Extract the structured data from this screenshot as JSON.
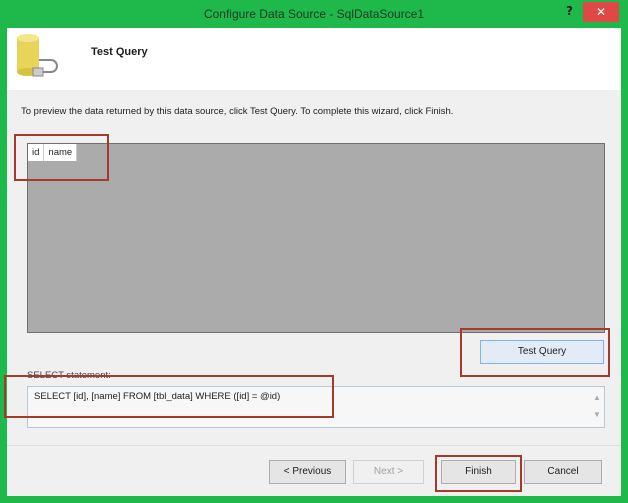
{
  "window": {
    "title": "Configure Data Source - SqlDataSource1",
    "help": "?",
    "close": "✕"
  },
  "header": {
    "title": "Test Query",
    "icon": "database-plug-icon"
  },
  "instructions": "To preview the data returned by this data source, click Test Query. To complete this wizard, click Finish.",
  "grid": {
    "columns": [
      "id",
      "name"
    ]
  },
  "test_query_label": "Test Query",
  "select_label": "SELECT statement:",
  "select_statement": "SELECT [id], [name] FROM [tbl_data] WHERE ([id] = @id)",
  "buttons": {
    "previous": "< Previous",
    "next": "Next >",
    "finish": "Finish",
    "cancel": "Cancel"
  },
  "colors": {
    "frame": "#1fb84b",
    "highlight": "#a33a2a"
  }
}
